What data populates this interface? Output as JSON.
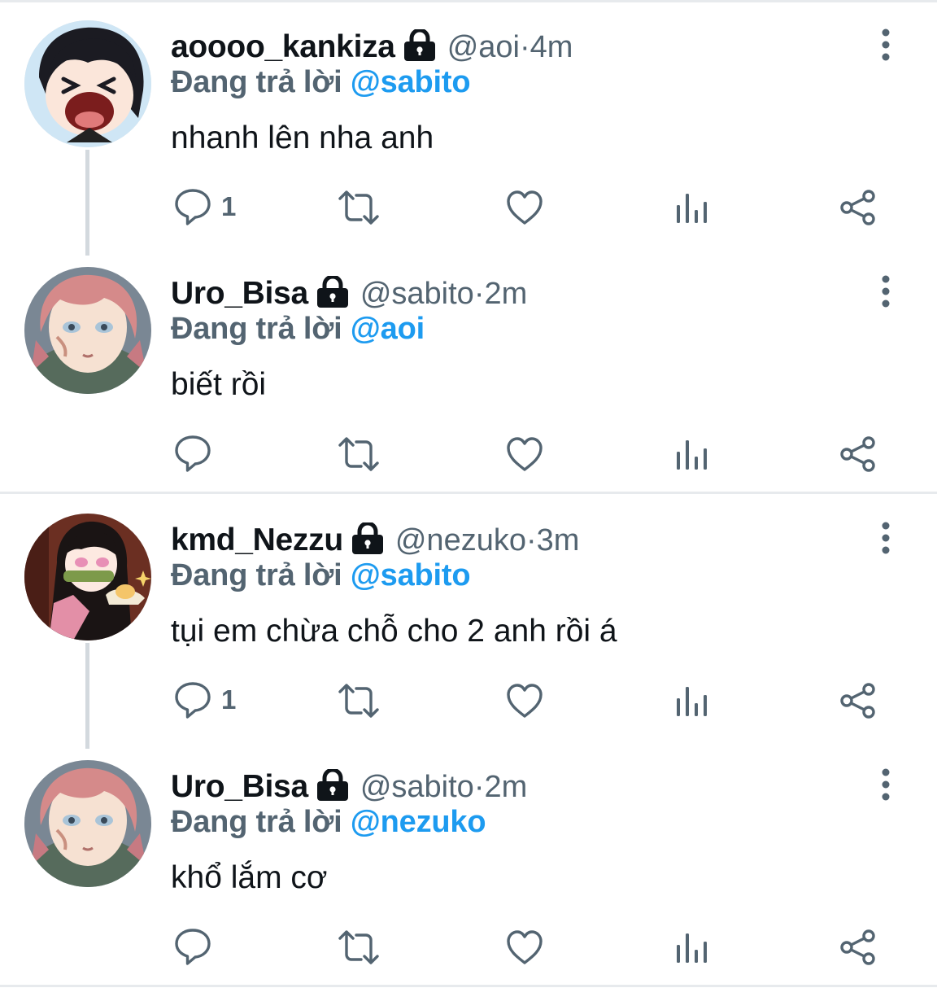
{
  "tweets": [
    {
      "name": "aoooo_kankiza",
      "handle": "@aoi",
      "time": "4m",
      "reply_prefix": "Đang trả lời",
      "reply_to": "@sabito",
      "text": "nhanh lên nha anh",
      "reply_count": "1",
      "avatar": "chibi-crying-avatar"
    },
    {
      "name": "Uro_Bisa",
      "handle": "@sabito",
      "time": "2m",
      "reply_prefix": "Đang trả lời",
      "reply_to": "@aoi",
      "text": "biết rồi",
      "reply_count": "",
      "avatar": "sabito-avatar"
    },
    {
      "name": "kmd_Nezzu",
      "handle": "@nezuko",
      "time": "3m",
      "reply_prefix": "Đang trả lời",
      "reply_to": "@sabito",
      "text": "tụi em chừa chỗ cho 2 anh rồi á",
      "reply_count": "1",
      "avatar": "nezuko-avatar"
    },
    {
      "name": "Uro_Bisa",
      "handle": "@sabito",
      "time": "2m",
      "reply_prefix": "Đang trả lời",
      "reply_to": "@nezuko",
      "text": "khổ lắm cơ",
      "reply_count": "",
      "avatar": "sabito-avatar"
    }
  ],
  "separator": " · ",
  "colors": {
    "name": "#0f1419",
    "secondary": "#536471",
    "mention": "#1d9bf0",
    "icon": "#536471",
    "divider": "#e7eaed"
  },
  "icons": [
    "lock-icon",
    "more-icon",
    "reply-icon",
    "retweet-icon",
    "like-icon",
    "views-icon",
    "share-icon"
  ]
}
